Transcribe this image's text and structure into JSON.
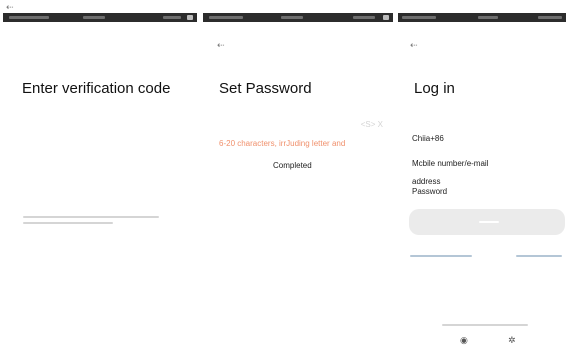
{
  "page_back_icon": "back-arrow-icon",
  "screens": {
    "verification": {
      "title": "Enter verification code"
    },
    "set_password": {
      "title": "Set Password",
      "eye_toggle": "<S> X",
      "hint": "6-20 characters, irrJuding letter and",
      "completed_label": "Completed"
    },
    "login": {
      "title": "Log in",
      "country_code": "Chiia+86",
      "account_label_line1": "Mcbile number/e-mail",
      "account_label_line2": "address",
      "password_label": "Password"
    }
  },
  "colors": {
    "status_bar": "#2c2c2c",
    "hint": "#f0906c",
    "login_button": "#ebebeb",
    "link": "#b4c6d6"
  }
}
